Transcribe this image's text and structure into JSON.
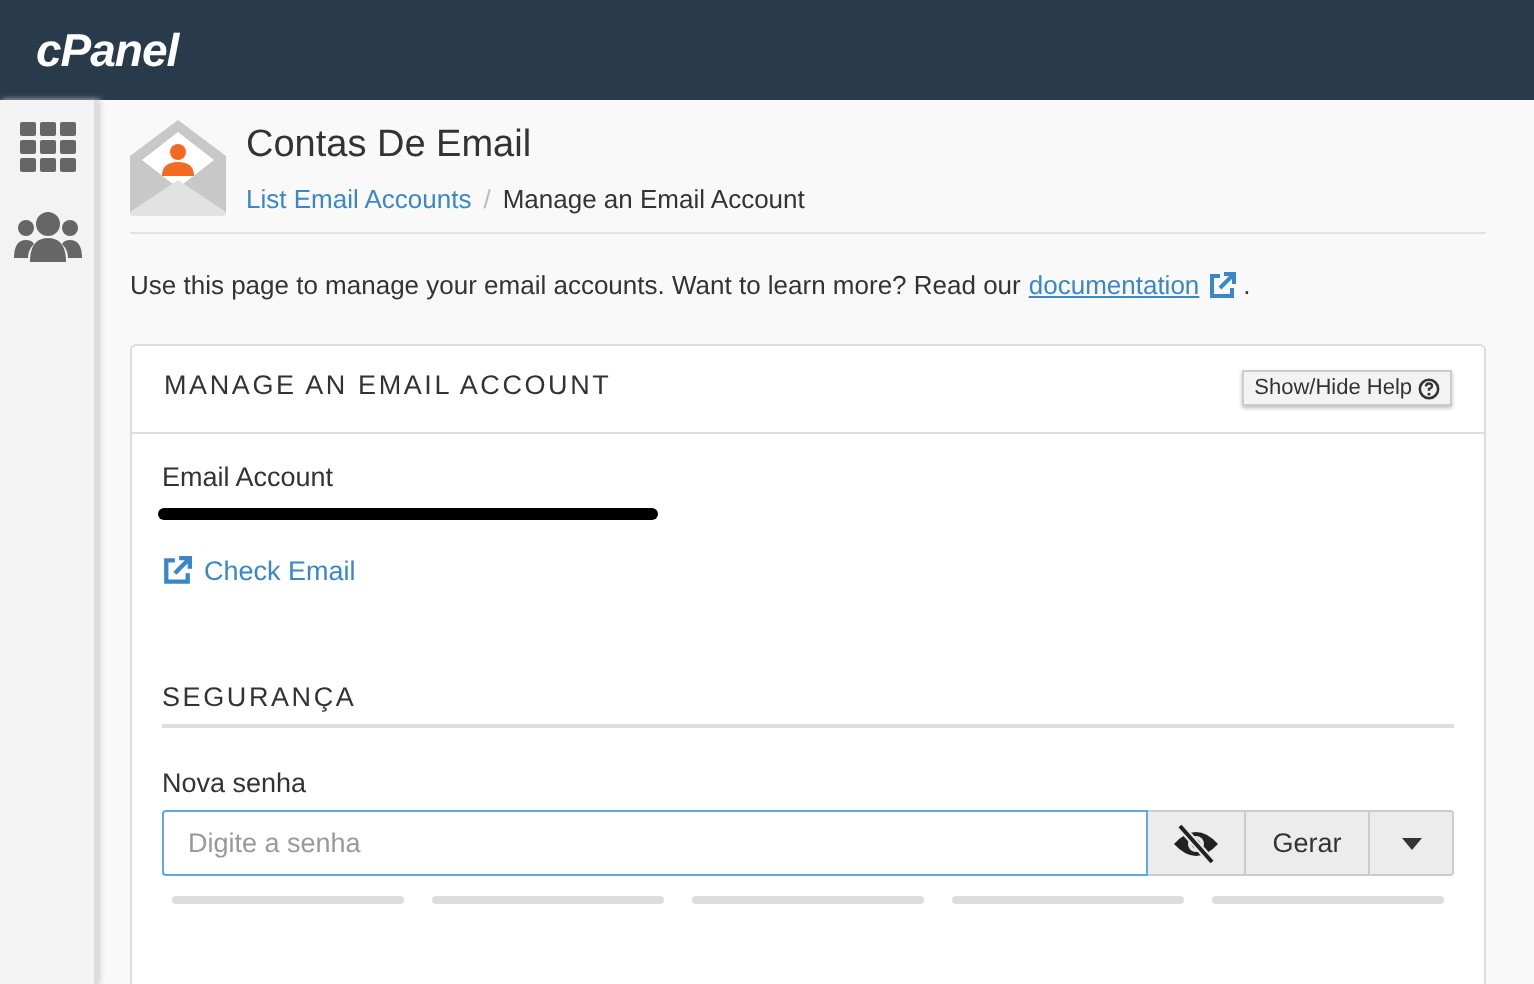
{
  "header": {
    "logo": "cPanel"
  },
  "sidebar": {
    "items": [
      {
        "kind": "grid"
      },
      {
        "kind": "users"
      }
    ]
  },
  "page": {
    "title": "Contas De Email",
    "breadcrumb": [
      {
        "label": "List Email Accounts",
        "kind": "link"
      },
      {
        "label": "Manage an Email Account",
        "kind": "current"
      }
    ],
    "separator": "/"
  },
  "intro": {
    "text": "Use this page to manage your email accounts. Want to learn more? Read our",
    "link": "documentation",
    "end": "."
  },
  "card": {
    "title": "MANAGE AN EMAIL ACCOUNT",
    "help_button": "Show/Hide Help",
    "email_label": "Email Account",
    "email_redacted": true,
    "check_email": "Check Email",
    "section": "SEGURANÇA",
    "password_label": "Nova senha",
    "password": {
      "placeholder": "Digite a senha",
      "visible": false
    },
    "generate_button": "Gerar"
  }
}
